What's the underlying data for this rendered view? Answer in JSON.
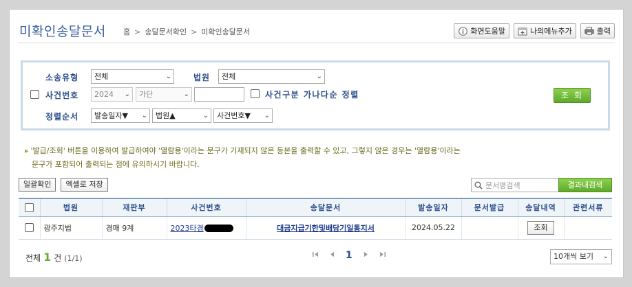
{
  "header": {
    "title": "미확인송달문서",
    "breadcrumb": [
      "홈",
      "송달문서확인",
      "미확인송달문서"
    ],
    "buttons": {
      "help": "화면도움말",
      "add_menu": "나의메뉴추가",
      "print": "출력"
    }
  },
  "search": {
    "type_label": "소송유형",
    "type_value": "전체",
    "court_label": "법원",
    "court_value": "전체",
    "case_label": "사건번호",
    "case_year": "2024",
    "case_kind": "가단",
    "case_number": "",
    "sort_option_label": "사건구분 가나다순 정렬",
    "order_label": "정렬순서",
    "order1": "발송일자▼",
    "order2": "법원▲",
    "order3": "사건번호▼",
    "query_button": "조 회"
  },
  "notice": {
    "line1": "'발급/조회' 버튼을 이용하여 발급하여야 '열람용'이라는 문구가 기재되지 않은 등본을 출력할 수 있고, 그렇지 않은 경우는 '열람용'이라는",
    "line2": "문구가 포함되어 출력되는 점에 유의하시기 바랍니다."
  },
  "actions": {
    "bulk_confirm": "일괄확인",
    "excel_save": "엑셀로 저장",
    "doc_search_placeholder": "문서명검색",
    "result_search": "결과내검색"
  },
  "table": {
    "headers": [
      "법원",
      "재판부",
      "사건번호",
      "송달문서",
      "발송일자",
      "문서발급",
      "송달내역",
      "관련서류"
    ],
    "rows": [
      {
        "court": "광주지법",
        "division": "경매 9계",
        "case_no": "2023타경",
        "document": "대금지급기한및배당기일통지서",
        "sent_date": "2024.05.22",
        "issue": "",
        "history_button": "조회",
        "related": ""
      }
    ]
  },
  "footer": {
    "total_label": "전체",
    "total_count": "1",
    "total_unit": "건",
    "page_info": "(1/1)",
    "current_page": "1",
    "per_page": "10개씩 보기"
  },
  "colors": {
    "title": "#3a5f9f",
    "label": "#2b4e8c",
    "green_button": "#6bb535",
    "search_border": "#c7dbe8"
  }
}
